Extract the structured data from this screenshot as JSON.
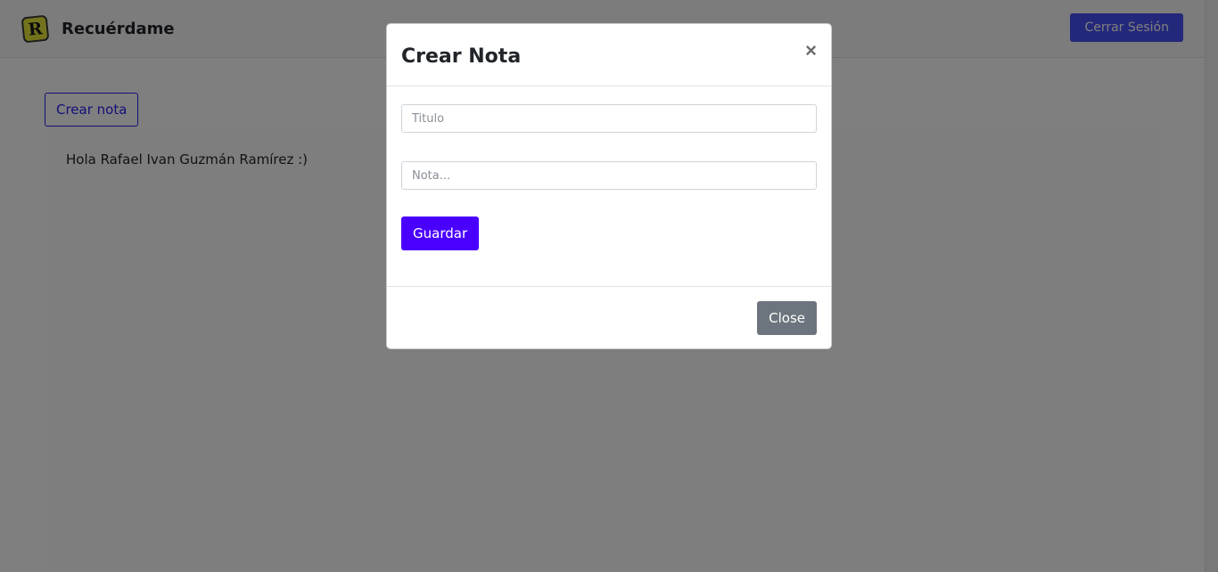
{
  "navbar": {
    "logo_letter": "R",
    "brand": "Recuérdame",
    "logout_label": "Cerrar Sesión"
  },
  "main": {
    "create_note_label": "Crear nota",
    "greeting": "Hola Rafael Ivan Guzmán Ramírez :)"
  },
  "modal": {
    "title": "Crear Nota",
    "close_symbol": "×",
    "title_placeholder": "Titulo",
    "note_placeholder": "Nota...",
    "save_label": "Guardar",
    "close_label": "Close"
  },
  "colors": {
    "primary": "#4a00ff",
    "logout": "#4650f5",
    "secondary": "#6c757d",
    "logo": "#e8e63a"
  }
}
